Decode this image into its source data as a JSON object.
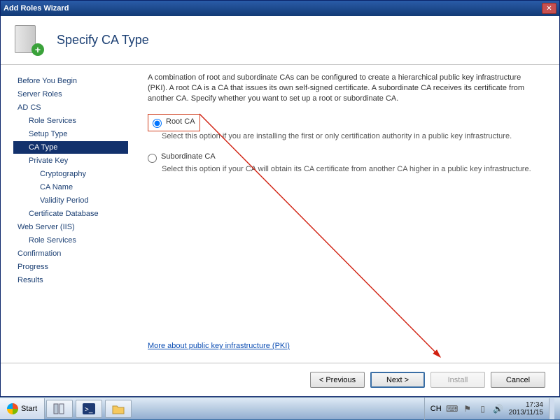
{
  "window": {
    "title": "Add Roles Wizard"
  },
  "header": {
    "title": "Specify CA Type"
  },
  "nav": {
    "items": [
      {
        "label": "Before You Begin",
        "indent": 0
      },
      {
        "label": "Server Roles",
        "indent": 0
      },
      {
        "label": "AD CS",
        "indent": 0
      },
      {
        "label": "Role Services",
        "indent": 1
      },
      {
        "label": "Setup Type",
        "indent": 1
      },
      {
        "label": "CA Type",
        "indent": 1,
        "selected": true
      },
      {
        "label": "Private Key",
        "indent": 1
      },
      {
        "label": "Cryptography",
        "indent": 2
      },
      {
        "label": "CA Name",
        "indent": 2
      },
      {
        "label": "Validity Period",
        "indent": 2
      },
      {
        "label": "Certificate Database",
        "indent": 1
      },
      {
        "label": "Web Server (IIS)",
        "indent": 0
      },
      {
        "label": "Role Services",
        "indent": 1
      },
      {
        "label": "Confirmation",
        "indent": 0
      },
      {
        "label": "Progress",
        "indent": 0
      },
      {
        "label": "Results",
        "indent": 0
      }
    ]
  },
  "content": {
    "description": "A combination of root and subordinate CAs can be configured to create a hierarchical public key infrastructure (PKI). A root CA is a CA that issues its own self-signed certificate. A subordinate CA receives its certificate from another CA. Specify whether you want to set up a root or subordinate CA.",
    "options": {
      "root": {
        "label": "Root CA",
        "desc": "Select this option if you are installing the first or only certification authority in a public key infrastructure."
      },
      "subordinate": {
        "label": "Subordinate CA",
        "desc": "Select this option if your CA will obtain its CA certificate from another CA higher in a public key infrastructure."
      }
    },
    "more_link": "More about public key infrastructure (PKI)"
  },
  "buttons": {
    "prev": "< Previous",
    "next": "Next >",
    "install": "Install",
    "cancel": "Cancel"
  },
  "taskbar": {
    "start": "Start",
    "ime": "CH",
    "time": "17:34",
    "date": "2013/11/15"
  }
}
